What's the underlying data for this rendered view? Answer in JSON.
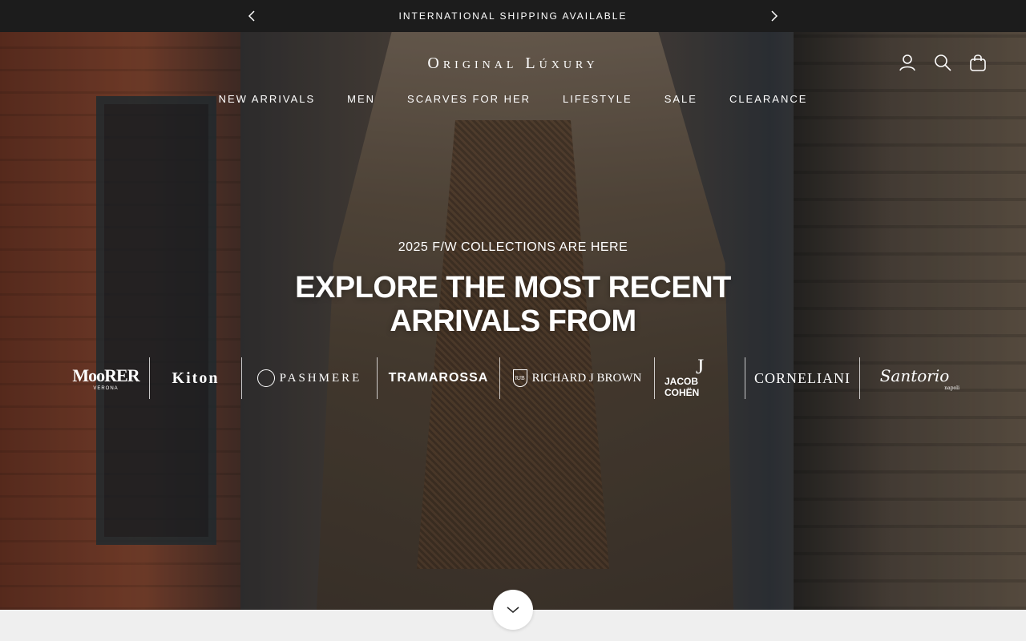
{
  "announcement": {
    "text": "INTERNATIONAL SHIPPING AVAILABLE",
    "prev_icon": "chevron-left-icon",
    "next_icon": "chevron-right-icon"
  },
  "header": {
    "logo": "Original Lúxury",
    "icons": [
      "account-icon",
      "search-icon",
      "bag-icon"
    ],
    "nav": [
      "NEW ARRIVALS",
      "MEN",
      "SCARVES FOR HER",
      "LIFESTYLE",
      "SALE",
      "CLEARANCE"
    ]
  },
  "hero": {
    "subtitle": "2025 F/W COLLECTIONS ARE HERE",
    "headline": "EXPLORE THE MOST RECENT ARRIVALS FROM"
  },
  "brands": {
    "moorer": {
      "name": "MooRER",
      "sub": "VERONA"
    },
    "kiton": {
      "name": "Kiton"
    },
    "pashmere": {
      "name": "PASHMERE"
    },
    "tramarossa": {
      "name": "TRAMAROSSA"
    },
    "richard": {
      "name": "RICHARD J BROWN",
      "mark": "RJB"
    },
    "jacob": {
      "name": "JACOB COHËN",
      "mark": "J"
    },
    "corneliani": {
      "name": "CORNELIANI"
    },
    "santorio": {
      "name": "Santorio",
      "sub": "napoli"
    }
  },
  "scroll_icon": "chevron-down-icon",
  "colors": {
    "announcement_bg": "#1c1c1c",
    "text_on_dark": "#ffffff",
    "page_bg": "#efefef"
  }
}
